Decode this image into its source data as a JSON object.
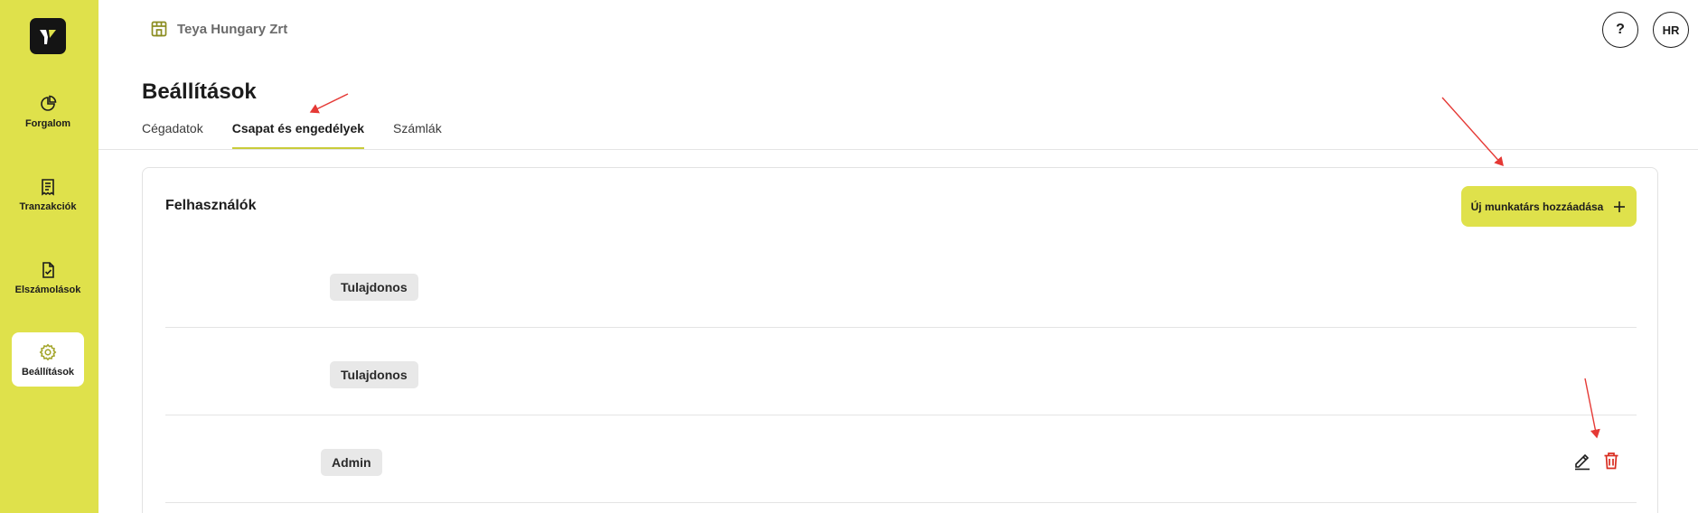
{
  "sidebar": {
    "items": [
      {
        "label": "Forgalom",
        "icon": "pie-chart-icon"
      },
      {
        "label": "Tranzakciók",
        "icon": "receipt-icon"
      },
      {
        "label": "Elszámolások",
        "icon": "file-check-icon"
      },
      {
        "label": "Beállítások",
        "icon": "gear-icon",
        "active": true
      }
    ]
  },
  "header": {
    "org_name": "Teya Hungary Zrt",
    "help_label": "?",
    "avatar_initials": "HR"
  },
  "page": {
    "title": "Beállítások",
    "tabs": [
      {
        "label": "Cégadatok",
        "active": false
      },
      {
        "label": "Csapat és engedélyek",
        "active": true
      },
      {
        "label": "Számlák",
        "active": false
      }
    ]
  },
  "users": {
    "title": "Felhasználók",
    "add_button_label": "Új munkatárs hozzáadása",
    "rows": [
      {
        "role": "Tulajdonos"
      },
      {
        "role": "Tulajdonos"
      },
      {
        "role": "Admin"
      }
    ]
  },
  "colors": {
    "brand": "#dfe14b",
    "delete": "#d92d20",
    "annotation_arrow": "#e53935"
  }
}
